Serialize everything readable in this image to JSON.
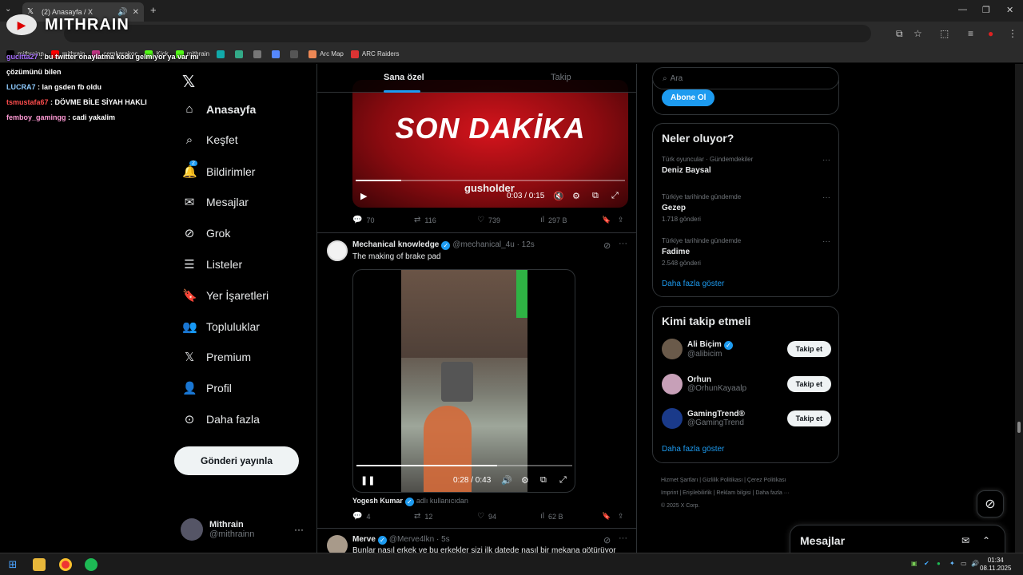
{
  "browser": {
    "tab_title": "(2) Anasayfa / X",
    "new_tab": "+",
    "window_controls": [
      "—",
      "❐",
      "✕"
    ],
    "bookmarks": [
      {
        "label": "mithrainn",
        "icon": "x-icon",
        "color": "#000000"
      },
      {
        "label": "mithrain",
        "icon": "youtube-icon",
        "color": "#ff0000"
      },
      {
        "label": "cemkarakoc",
        "icon": "instagram-icon",
        "color": "#c13584"
      },
      {
        "label": "Kick",
        "icon": "kick-icon",
        "color": "#53fc18"
      },
      {
        "label": "mithrain",
        "icon": "kick-icon",
        "color": "#53fc18"
      },
      {
        "label": "",
        "icon": "app-icon",
        "color": "#1aa"
      },
      {
        "label": "",
        "icon": "app-icon",
        "color": "#3a8"
      },
      {
        "label": "",
        "icon": "app-icon",
        "color": "#777"
      },
      {
        "label": "",
        "icon": "gemini-icon",
        "color": "#58f"
      },
      {
        "label": "",
        "icon": "app-icon",
        "color": "#555"
      },
      {
        "label": "Arc Map",
        "icon": "arc-icon",
        "color": "#e85"
      },
      {
        "label": "ARC Raiders",
        "icon": "arc-raiders-icon",
        "color": "#d33"
      }
    ]
  },
  "overlay": {
    "brand": "MITHRAIN",
    "chat": [
      {
        "user": "gucitta27",
        "user_color": "#a970ff",
        "message": "bu twitter onaylatma kodu gelmiyor ya var mı çözümünü bilen"
      },
      {
        "user": "LUCRA7",
        "user_color": "#8ecbff",
        "message": "lan gsden fb oldu"
      },
      {
        "user": "tsmustafa67",
        "user_color": "#ff4d4d",
        "message": "DÖVME BİLE SİYAH HAKLI"
      },
      {
        "user": "femboy_gamingg",
        "user_color": "#ff9ad5",
        "message": "cadi yakalim"
      }
    ]
  },
  "nav": {
    "items": [
      {
        "label": "Anasayfa",
        "icon": "home-icon"
      },
      {
        "label": "Keşfet",
        "icon": "search-icon"
      },
      {
        "label": "Bildirimler",
        "icon": "bell-icon",
        "badge": "2"
      },
      {
        "label": "Mesajlar",
        "icon": "mail-icon"
      },
      {
        "label": "Grok",
        "icon": "grok-icon"
      },
      {
        "label": "Listeler",
        "icon": "list-icon"
      },
      {
        "label": "Yer İşaretleri",
        "icon": "bookmark-icon"
      },
      {
        "label": "Topluluklar",
        "icon": "communities-icon"
      },
      {
        "label": "Premium",
        "icon": "x-icon"
      },
      {
        "label": "Profil",
        "icon": "person-icon"
      },
      {
        "label": "Daha fazla",
        "icon": "more-circle-icon"
      }
    ],
    "post_button": "Gönderi yayınla",
    "account": {
      "name": "Mithrain",
      "handle": "@mithrainn"
    }
  },
  "timeline": {
    "tabs": [
      "Sana özel",
      "Takip"
    ],
    "post1": {
      "video_headline": "SON DAKİKA",
      "video_watermark": "gusholder",
      "time": "0:03 / 0:15",
      "progress": 0.17,
      "stats": {
        "replies": "70",
        "reposts": "116",
        "likes": "739",
        "views": "297 B"
      }
    },
    "post2": {
      "name": "Mechanical knowledge",
      "handle": "@mechanical_4u",
      "time_ago": "· 12s",
      "text": "The making of brake pad",
      "video_time": "0:28 / 0:43",
      "progress": 0.65,
      "credit_name": "Yogesh Kumar",
      "credit_suffix": "adlı kullanıcıdan",
      "stats": {
        "replies": "4",
        "reposts": "12",
        "likes": "94",
        "views": "62 B"
      }
    },
    "post3": {
      "name": "Merve",
      "handle": "@Merve4lkn",
      "time_ago": "· 5s",
      "text": "Bunlar nasıl erkek ve bu erkekler sizi ilk datede nasıl bir mekana götürüyor"
    }
  },
  "right": {
    "search_placeholder": "Ara",
    "subscribe": "Abone Ol",
    "trends_title": "Neler oluyor?",
    "trends": [
      {
        "context": "Türk oyuncular · Gündemdekiler",
        "topic": "Deniz Baysal",
        "count": ""
      },
      {
        "context": "Türkiye tarihinde gündemde",
        "topic": "Gezep",
        "count": "1.718 gönderi"
      },
      {
        "context": "Türkiye tarihinde gündemde",
        "topic": "Fadime",
        "count": "2.548 gönderi"
      }
    ],
    "show_more": "Daha fazla göster",
    "who_title": "Kimi takip etmeli",
    "who": [
      {
        "name": "Ali Biçim",
        "handle": "@alibicim",
        "verified": true,
        "color": "#6a5a4a"
      },
      {
        "name": "Orhun",
        "handle": "@OrhunKayaalp",
        "verified": false,
        "color": "#c7a0b8"
      },
      {
        "name": "GamingTrend®",
        "handle": "@GamingTrend",
        "verified": false,
        "color": "#1a3a8a"
      }
    ],
    "follow_label": "Takip et",
    "footer": [
      "Hizmet Şartları",
      "Gizlilik Politikası",
      "Çerez Politikası",
      "Imprint",
      "Erişilebilirlik",
      "Reklam bilgisi",
      "Daha fazla ···",
      "© 2025 X Corp."
    ]
  },
  "dm": {
    "title": "Mesajlar"
  },
  "taskbar": {
    "time": "01:34",
    "date": "08.11.2025"
  }
}
